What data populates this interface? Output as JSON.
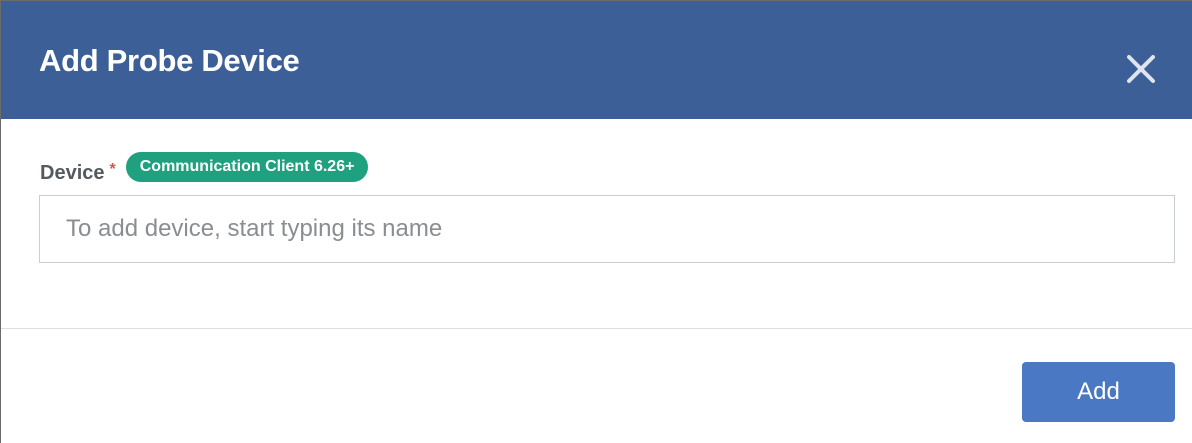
{
  "dialog": {
    "title": "Add Probe Device",
    "close_icon": "close-icon",
    "header_color": "#3d5f97"
  },
  "device_field": {
    "label": "Device",
    "required_marker": "*",
    "badge": "Communication Client 6.26+",
    "badge_color": "#1fa07e",
    "value": "",
    "placeholder": "To add device, start typing its name"
  },
  "footer": {
    "add_label": "Add",
    "add_color": "#4a78c2"
  }
}
